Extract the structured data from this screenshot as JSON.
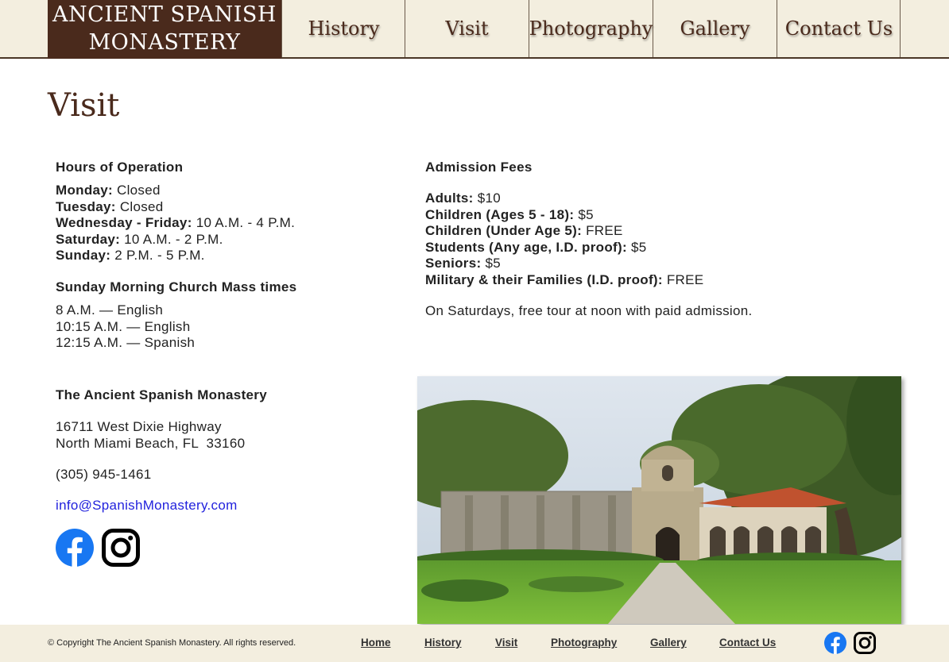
{
  "header": {
    "logo_line1": "ANCIENT SPANISH",
    "logo_line2": "MONASTERY",
    "nav": [
      "History",
      "Visit",
      "Photography",
      "Gallery",
      "Contact Us"
    ]
  },
  "page_title": "Visit",
  "hours": {
    "title": "Hours of Operation",
    "rows": [
      {
        "day": "Monday:",
        "time": "Closed"
      },
      {
        "day": "Tuesday:",
        "time": "Closed"
      },
      {
        "day": "Wednesday - Friday:",
        "time": "10 A.M. - 4 P.M."
      },
      {
        "day": "Saturday:",
        "time": "10 A.M. - 2 P.M."
      },
      {
        "day": "Sunday:",
        "time": "2 P.M. - 5 P.M."
      }
    ]
  },
  "mass": {
    "title": "Sunday Morning Church Mass times",
    "rows": [
      "8 A.M. — English",
      "10:15 A.M. — English",
      "12:15 A.M. — Spanish"
    ]
  },
  "contact": {
    "title": "The Ancient Spanish Monastery",
    "address1": "16711 West Dixie Highway",
    "address2": "North Miami Beach, FL  33160",
    "phone": "(305) 945-1461",
    "email": "info@SpanishMonastery.com"
  },
  "fees": {
    "title": "Admission Fees",
    "rows": [
      {
        "label": "Adults:",
        "value": "$10"
      },
      {
        "label": "Children (Ages 5 - 18):",
        "value": "$5"
      },
      {
        "label": "Children (Under Age 5):",
        "value": "FREE"
      },
      {
        "label": "Students (Any age, I.D. proof):",
        "value": "$5"
      },
      {
        "label": "Seniors:",
        "value": "$5"
      },
      {
        "label": "Military & their Families (I.D. proof):",
        "value": "FREE"
      }
    ],
    "note": "On Saturdays, free tour at noon with paid admission."
  },
  "footer": {
    "copyright": "© Copyright The Ancient Spanish Monastery. All rights reserved.",
    "links": [
      "Home",
      "History",
      "Visit",
      "Photography",
      "Gallery",
      "Contact Us"
    ]
  },
  "icons": {
    "facebook": "facebook-icon",
    "instagram": "instagram-icon"
  },
  "colors": {
    "brand_brown": "#4a2a1c",
    "header_bg": "#f3eedf",
    "link_blue": "#2222dd",
    "facebook_blue": "#1877f2"
  }
}
